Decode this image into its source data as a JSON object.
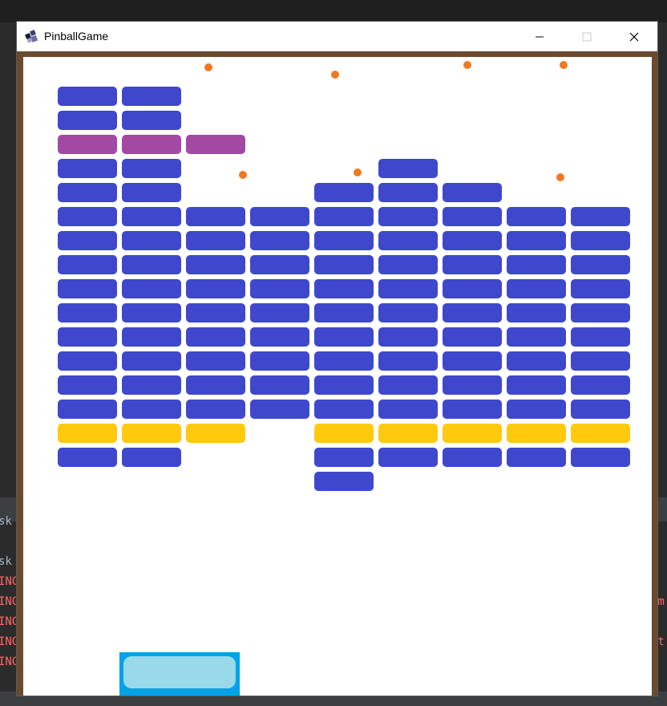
{
  "window": {
    "title": "PinballGame",
    "minimize_symbol": "—",
    "maximize_symbol": "☐",
    "close_symbol": "✕",
    "icon": "java-cup-icon"
  },
  "background_console": {
    "left_lines": [
      "sk",
      "sk",
      "ING",
      "ING",
      "ING",
      "ING",
      "ING"
    ],
    "right_lines": [
      "/m",
      "nt"
    ]
  },
  "game": {
    "colors": {
      "frame": "#6b4a2e",
      "brick_blue": "#3f48cc",
      "brick_purple": "#a349a4",
      "brick_yellow": "#ffc90e",
      "ball": "#f07a22",
      "paddle_border": "#00a2e8",
      "paddle_fill": "#99d9ea"
    },
    "brick_legend": {
      "b": "blue",
      "p": "purple",
      "y": "yellow",
      ".": "empty"
    },
    "brick_grid": [
      "bb.......",
      "bb.......",
      "ppp......",
      "bb...b...",
      "bb..bbb..",
      "bbbbbbbbb",
      "bbbbbbbbb",
      "bbbbbbbbb",
      "bbbbbbbbb",
      "bbbbbbbbb",
      "bbbbbbbbb",
      "bbbbbbbbb",
      "bbbbbbbbb",
      "bbbbbbbbb",
      "yyy.yyyyy",
      "bb..bbbbb",
      "....b...."
    ],
    "ball_count": 7
  }
}
